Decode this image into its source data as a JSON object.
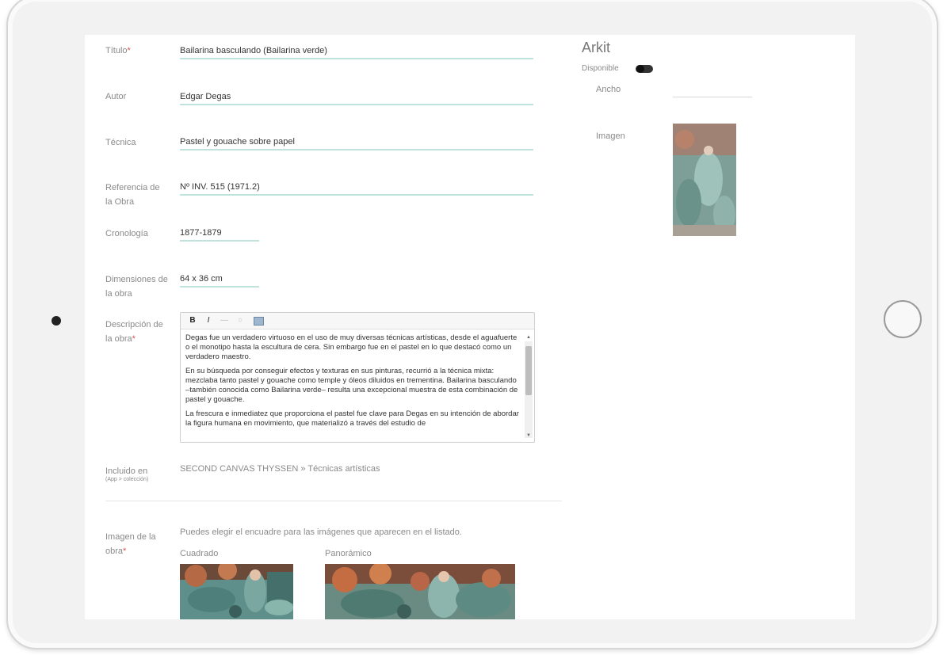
{
  "form": {
    "title_label": "Título",
    "title_value": "Bailarina basculando (Bailarina verde)",
    "author_label": "Autor",
    "author_value": "Edgar Degas",
    "technique_label": "Técnica",
    "technique_value": "Pastel y gouache sobre papel",
    "reference_label": "Referencia de la Obra",
    "reference_value": "Nº INV. 515 (1971.2)",
    "chronology_label": "Cronología",
    "chronology_value": "1877-1879",
    "dimensions_label": "Dimensiones de la obra",
    "dimensions_value": "64 x 36 cm",
    "description_label": "Descripción de la obra",
    "description_paragraphs": [
      "Degas fue un verdadero virtuoso en el uso de muy diversas técnicas artísticas, desde el aguafuerte o el monotipo hasta la escultura de cera. Sin embargo fue en el pastel en lo que destacó como un verdadero maestro.",
      "En su búsqueda por conseguir efectos y texturas en sus pinturas, recurrió a la técnica mixta: mezclaba tanto pastel y gouache como temple y óleos diluidos en trementina. Bailarina basculando –también conocida como Bailarina verde– resulta una excepcional muestra de esta combinación de pastel y gouache.",
      "La frescura e inmediatez que proporciona el pastel fue clave para Degas en su intención de abordar la figura humana en movimiento, que materializó a través del estudio de"
    ],
    "toolbar": {
      "bold": "B",
      "italic": "I",
      "link": "—",
      "unlink": "○"
    },
    "included_label": "Incluido en",
    "included_sub": "(App > colección)",
    "included_value": "SECOND CANVAS THYSSEN » Técnicas artísticas",
    "image_label": "Imagen de la obra",
    "image_hint": "Puedes elegir el encuadre para las imágenes que aparecen en el listado.",
    "square_label": "Cuadrado",
    "panoramic_label": "Panorámico"
  },
  "arkit": {
    "title": "Arkit",
    "available_label": "Disponible",
    "available_on": true,
    "width_label": "Ancho",
    "width_value": "",
    "image_label": "Imagen"
  },
  "colors": {
    "accent_underline": "#bfe3dc",
    "required": "#d9534f"
  }
}
